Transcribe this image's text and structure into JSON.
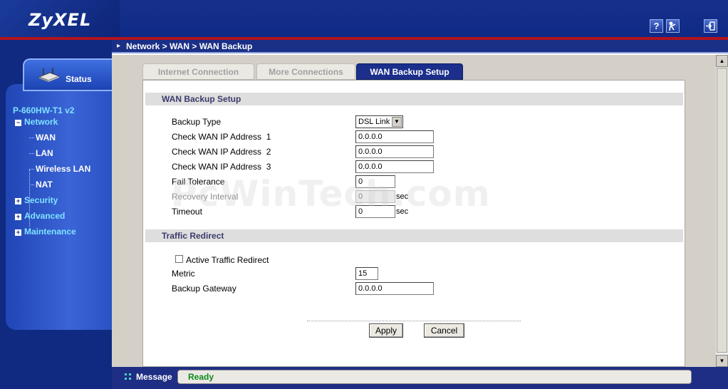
{
  "brand": {
    "logo": "ZyXEL"
  },
  "header": {
    "icons": [
      "help-icon",
      "wizard-icon",
      "logout-icon"
    ],
    "help_glyph": "?"
  },
  "breadcrumb": "Network > WAN > WAN Backup",
  "sidebar": {
    "status_label": "Status",
    "model": "P-660HW-T1 v2",
    "network": "Network",
    "network_items": [
      "WAN",
      "LAN",
      "Wireless LAN",
      "NAT"
    ],
    "security": "Security",
    "advanced": "Advanced",
    "maintenance": "Maintenance"
  },
  "tabs": [
    {
      "label": "Internet Connection",
      "active": false
    },
    {
      "label": "More Connections",
      "active": false
    },
    {
      "label": "WAN Backup Setup",
      "active": true
    }
  ],
  "wan_backup": {
    "title": "WAN Backup Setup",
    "backup_type_label": "Backup Type",
    "backup_type_value": "DSL Link",
    "check_ip_1_label": "Check WAN IP Address  1",
    "check_ip_1": "0.0.0.0",
    "check_ip_2_label": "Check WAN IP Address  2",
    "check_ip_2": "0.0.0.0",
    "check_ip_3_label": "Check WAN IP Address  3",
    "check_ip_3": "0.0.0.0",
    "fail_tolerance_label": "Fail Tolerance",
    "fail_tolerance": "0",
    "recovery_interval_label": "Recovery Interval",
    "recovery_interval": "0",
    "timeout_label": "Timeout",
    "timeout": "0",
    "sec_unit": "sec"
  },
  "traffic_redirect": {
    "title": "Traffic Redirect",
    "active_label": "Active Traffic Redirect",
    "active_checked": false,
    "metric_label": "Metric",
    "metric": "15",
    "gateway_label": "Backup Gateway",
    "gateway": "0.0.0.0"
  },
  "buttons": {
    "apply": "Apply",
    "cancel": "Cancel"
  },
  "statusbar": {
    "label": "Message",
    "text": "Ready",
    "text_color": "#0d8a1d"
  },
  "watermark": "PcWinTech.com"
}
